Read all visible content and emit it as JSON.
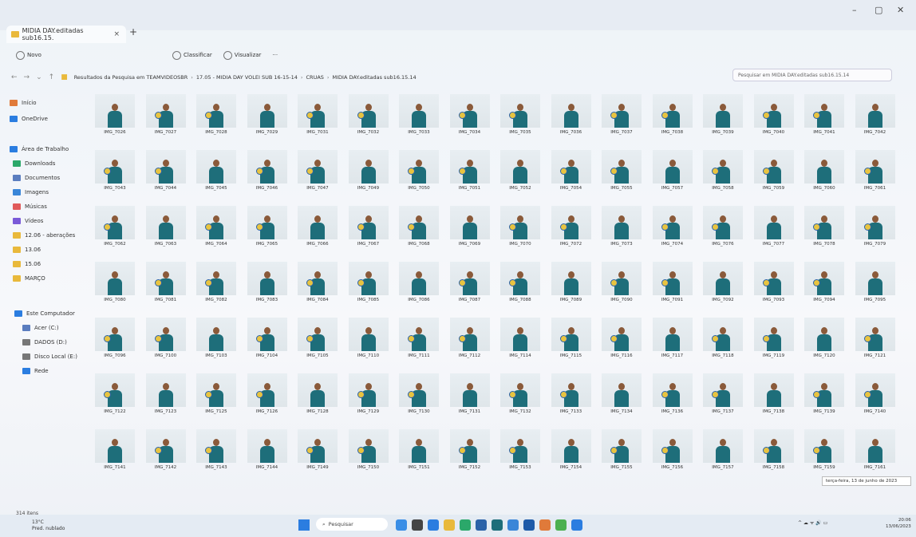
{
  "window": {
    "tab_title": "MIDIA DAY.editadas sub16.15.",
    "tab_close": "×",
    "new_tab": "+",
    "controls": [
      "–",
      "▢",
      "✕"
    ]
  },
  "toolbar": {
    "new_label": "Novo",
    "sort_label": "Classificar",
    "view_label": "Visualizar",
    "more_label": "···"
  },
  "address": {
    "crumbs": [
      "Resultados da Pesquisa em TEAMVIDEOSBR",
      "17.05 - MIDIA DAY VOLEI SUB 16-15-14",
      "CRUAS",
      "MIDIA DAY.editadas sub16.15.14"
    ],
    "search_placeholder": "Pesquisar em MIDIA DAY.editadas sub16.15.14"
  },
  "sidebar": {
    "items": [
      {
        "label": "Início",
        "icon": "home-icon",
        "color": "#e07a3a"
      },
      {
        "label": "OneDrive",
        "icon": "cloud-icon",
        "color": "#2b7de0"
      },
      {
        "label": "Área de Trabalho",
        "icon": "desktop-icon",
        "color": "#2b7de0"
      },
      {
        "label": "Downloads",
        "icon": "download-icon",
        "color": "#2ba86a"
      },
      {
        "label": "Documentos",
        "icon": "document-icon",
        "color": "#5a7dbf"
      },
      {
        "label": "Imagens",
        "icon": "image-icon",
        "color": "#3a86d8"
      },
      {
        "label": "Músicas",
        "icon": "music-icon",
        "color": "#e05a5a"
      },
      {
        "label": "Vídeos",
        "icon": "video-icon",
        "color": "#7a5ad8"
      },
      {
        "label": "12.06 - aberações",
        "icon": "folder-icon",
        "color": "#e9b93b"
      },
      {
        "label": "13.06",
        "icon": "folder-icon",
        "color": "#e9b93b"
      },
      {
        "label": "15.06",
        "icon": "folder-icon",
        "color": "#e9b93b"
      },
      {
        "label": "MARÇO",
        "icon": "folder-icon",
        "color": "#e9b93b"
      },
      {
        "label": "Este Computador",
        "icon": "computer-icon",
        "color": "#2b7de0"
      },
      {
        "label": "Acer (C:)",
        "icon": "drive-icon",
        "color": "#5a7dbf"
      },
      {
        "label": "DADOS (D:)",
        "icon": "drive-icon",
        "color": "#777777"
      },
      {
        "label": "Disco Local (E:)",
        "icon": "drive-icon",
        "color": "#777777"
      },
      {
        "label": "Rede",
        "icon": "network-icon",
        "color": "#2b7de0"
      }
    ]
  },
  "files": [
    "IMG_7026",
    "IMG_7027",
    "IMG_7028",
    "IMG_7029",
    "IMG_7031",
    "IMG_7032",
    "IMG_7033",
    "IMG_7034",
    "IMG_7035",
    "IMG_7036",
    "IMG_7037",
    "IMG_7038",
    "IMG_7039",
    "IMG_7040",
    "IMG_7041",
    "IMG_7042",
    "IMG_7043",
    "IMG_7044",
    "IMG_7045",
    "IMG_7046",
    "IMG_7047",
    "IMG_7049",
    "IMG_7050",
    "IMG_7051",
    "IMG_7052",
    "IMG_7054",
    "IMG_7055",
    "IMG_7057",
    "IMG_7058",
    "IMG_7059",
    "IMG_7060",
    "IMG_7061",
    "IMG_7062",
    "IMG_7063",
    "IMG_7064",
    "IMG_7065",
    "IMG_7066",
    "IMG_7067",
    "IMG_7068",
    "IMG_7069",
    "IMG_7070",
    "IMG_7072",
    "IMG_7073",
    "IMG_7074",
    "IMG_7076",
    "IMG_7077",
    "IMG_7078",
    "IMG_7079",
    "IMG_7080",
    "IMG_7081",
    "IMG_7082",
    "IMG_7083",
    "IMG_7084",
    "IMG_7085",
    "IMG_7086",
    "IMG_7087",
    "IMG_7088",
    "IMG_7089",
    "IMG_7090",
    "IMG_7091",
    "IMG_7092",
    "IMG_7093",
    "IMG_7094",
    "IMG_7095",
    "IMG_7096",
    "IMG_7100",
    "IMG_7103",
    "IMG_7104",
    "IMG_7105",
    "IMG_7110",
    "IMG_7111",
    "IMG_7112",
    "IMG_7114",
    "IMG_7115",
    "IMG_7116",
    "IMG_7117",
    "IMG_7118",
    "IMG_7119",
    "IMG_7120",
    "IMG_7121",
    "IMG_7122",
    "IMG_7123",
    "IMG_7125",
    "IMG_7126",
    "IMG_7128",
    "IMG_7129",
    "IMG_7130",
    "IMG_7131",
    "IMG_7132",
    "IMG_7133",
    "IMG_7134",
    "IMG_7136",
    "IMG_7137",
    "IMG_7138",
    "IMG_7139",
    "IMG_7140",
    "IMG_7141",
    "IMG_7142",
    "IMG_7143",
    "IMG_7144",
    "IMG_7149",
    "IMG_7150",
    "IMG_7151",
    "IMG_7152",
    "IMG_7153",
    "IMG_7154",
    "IMG_7155",
    "IMG_7156",
    "IMG_7157",
    "IMG_7158",
    "IMG_7159",
    "IMG_7161"
  ],
  "status": {
    "item_count": "314 itens",
    "date_tooltip": "terça-feira, 13 de junho de 2023"
  },
  "taskbar": {
    "weather_temp": "13°C",
    "weather_desc": "Pred. nublado",
    "search_label": "Pesquisar",
    "time": "20:06",
    "date": "13/06/2023",
    "tray": "^  ☁  ᯤ  🔊  ▭"
  }
}
